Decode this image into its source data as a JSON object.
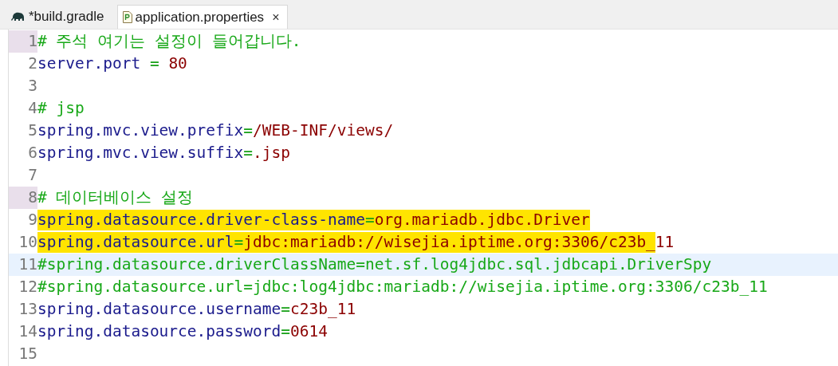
{
  "tabs": [
    {
      "label": "*build.gradle",
      "selected": false
    },
    {
      "label": "application.properties",
      "selected": true,
      "close": "×"
    }
  ],
  "editor": {
    "lines": [
      {
        "number": "1",
        "marker": true,
        "current": false,
        "tokens": [
          {
            "kind": "comment",
            "text": "# 주석 여기는 설정이 들어갑니다.",
            "marked": false
          }
        ]
      },
      {
        "number": "2",
        "marker": false,
        "current": false,
        "tokens": [
          {
            "kind": "key",
            "text": "server.port",
            "marked": false
          },
          {
            "kind": "eq",
            "text": " = ",
            "marked": false
          },
          {
            "kind": "value",
            "text": "80",
            "marked": false
          }
        ]
      },
      {
        "number": "3",
        "marker": false,
        "current": false
      },
      {
        "number": "4",
        "marker": false,
        "current": false,
        "tokens": [
          {
            "kind": "comment",
            "text": "# jsp",
            "marked": false
          }
        ]
      },
      {
        "number": "5",
        "marker": false,
        "current": false,
        "tokens": [
          {
            "kind": "key",
            "text": "spring.mvc.view.prefix",
            "marked": false
          },
          {
            "kind": "eq",
            "text": "=",
            "marked": false
          },
          {
            "kind": "value",
            "text": "/WEB-INF/views/",
            "marked": false
          }
        ]
      },
      {
        "number": "6",
        "marker": false,
        "current": false,
        "tokens": [
          {
            "kind": "key",
            "text": "spring.mvc.view.suffix",
            "marked": false
          },
          {
            "kind": "eq",
            "text": "=",
            "marked": false
          },
          {
            "kind": "value",
            "text": ".jsp",
            "marked": false
          }
        ]
      },
      {
        "number": "7",
        "marker": false,
        "current": false
      },
      {
        "number": "8",
        "marker": true,
        "current": false,
        "tokens": [
          {
            "kind": "comment",
            "text": "# 데이터베이스 설정",
            "marked": false
          }
        ]
      },
      {
        "number": "9",
        "marker": false,
        "current": false,
        "tokens": [
          {
            "kind": "key",
            "text": "spring.datasource.driver-class-name",
            "marked": true
          },
          {
            "kind": "eq",
            "text": "=",
            "marked": true
          },
          {
            "kind": "value",
            "text": "org.mariadb.jdbc.Driver",
            "marked": true
          }
        ]
      },
      {
        "number": "10",
        "marker": false,
        "current": false,
        "tokens": [
          {
            "kind": "key",
            "text": "spring.datasource.url",
            "marked": true
          },
          {
            "kind": "eq",
            "text": "=",
            "marked": true
          },
          {
            "kind": "value",
            "text": "jdbc:mariadb://wisejia.iptime.org:3306/c23b_",
            "marked": true
          },
          {
            "kind": "value",
            "text": "11",
            "marked": false
          }
        ]
      },
      {
        "number": "11",
        "marker": false,
        "current": true,
        "tokens": [
          {
            "kind": "comment",
            "text": "#spring.datasource.driverClassName=net.sf.log4jdbc.sql.jdbcapi.DriverSpy",
            "marked": false
          }
        ]
      },
      {
        "number": "12",
        "marker": false,
        "current": false,
        "tokens": [
          {
            "kind": "comment",
            "text": "#spring.datasource.url=jdbc:log4jdbc:mariadb://wisejia.iptime.org:3306/c23b_11",
            "marked": false
          }
        ]
      },
      {
        "number": "13",
        "marker": false,
        "current": false,
        "tokens": [
          {
            "kind": "key",
            "text": "spring.datasource.username",
            "marked": false
          },
          {
            "kind": "eq",
            "text": "=",
            "marked": false
          },
          {
            "kind": "value",
            "text": "c23b_11",
            "marked": false
          }
        ]
      },
      {
        "number": "14",
        "marker": false,
        "current": false,
        "tokens": [
          {
            "kind": "key",
            "text": "spring.datasource.password",
            "marked": false
          },
          {
            "kind": "eq",
            "text": "=",
            "marked": false
          },
          {
            "kind": "value",
            "text": "0614",
            "marked": false
          }
        ]
      },
      {
        "number": "15",
        "marker": false,
        "current": false
      }
    ]
  }
}
